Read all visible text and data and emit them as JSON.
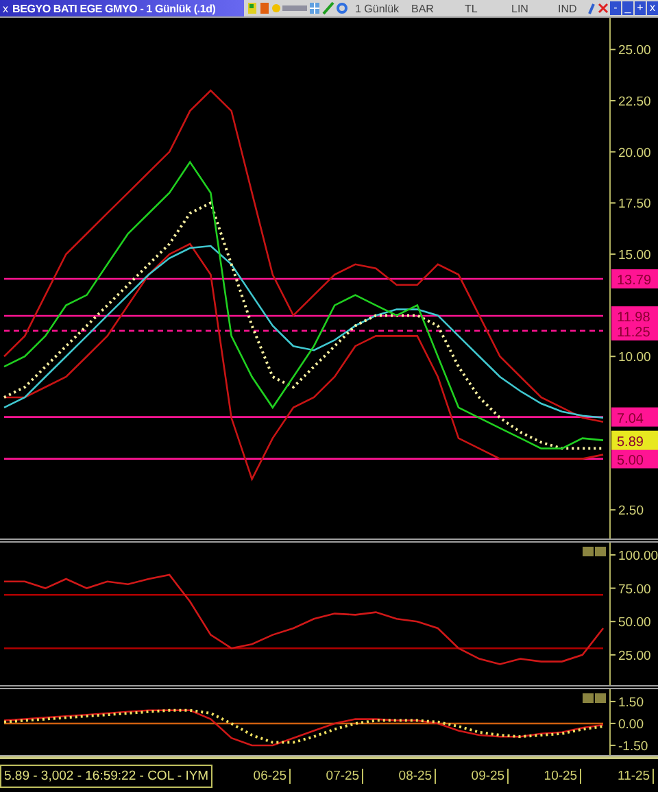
{
  "title_bar": {
    "close": "x",
    "title": "BEGYO BATI EGE GMYO - 1 Günlük (.1d)",
    "period": "1 Günlük",
    "style": "BAR",
    "currency": "TL",
    "scale": "LIN",
    "indicators": "IND",
    "window_buttons": [
      "-",
      "_",
      "+",
      "x"
    ]
  },
  "panels": [
    {
      "chart_data": {
        "type": "line",
        "ylim": [
          1.1,
          26.55
        ],
        "yticks": [
          {
            "value": 25,
            "label": "25.00"
          },
          {
            "value": 22.5,
            "label": "22.50"
          },
          {
            "value": 20,
            "label": "20.00"
          },
          {
            "value": 17.5,
            "label": "17.50"
          },
          {
            "value": 15,
            "label": "15.00"
          },
          {
            "value": 10,
            "label": "10.00"
          },
          {
            "value": 2.5,
            "label": "2.50"
          }
        ],
        "series": [
          {
            "name": "13.79",
            "color": "#ff1493",
            "values": [
              13.79,
              13.79,
              13.79,
              13.79,
              13.79,
              13.79,
              13.79,
              13.79,
              13.79,
              13.79,
              13.79,
              13.79,
              13.79,
              13.79,
              13.79,
              13.79,
              13.79,
              13.79,
              13.79,
              13.79,
              13.79,
              13.79,
              13.79,
              13.79,
              13.79,
              13.79,
              13.79,
              13.79,
              13.79,
              13.79
            ]
          },
          {
            "name": "11.98",
            "color": "#ff1493",
            "values": [
              11.98,
              11.98,
              11.98,
              11.98,
              11.98,
              11.98,
              11.98,
              11.98,
              11.98,
              11.98,
              11.98,
              11.98,
              11.98,
              11.98,
              11.98,
              11.98,
              11.98,
              11.98,
              11.98,
              11.98,
              11.98,
              11.98,
              11.98,
              11.98,
              11.98,
              11.98,
              11.98,
              11.98,
              11.98,
              11.98
            ]
          },
          {
            "name": "11.25",
            "color": "#ff1493",
            "line_style": "dashed",
            "values": [
              11.25,
              11.25,
              11.25,
              11.25,
              11.25,
              11.25,
              11.25,
              11.25,
              11.25,
              11.25,
              11.25,
              11.25,
              11.25,
              11.25,
              11.25,
              11.25,
              11.25,
              11.25,
              11.25,
              11.25,
              11.25,
              11.25,
              11.25,
              11.25,
              11.25,
              11.25,
              11.25,
              11.25,
              11.25,
              11.25
            ]
          },
          {
            "name": "7.04",
            "color": "#ff1493",
            "values": [
              7.04,
              7.04,
              7.04,
              7.04,
              7.04,
              7.04,
              7.04,
              7.04,
              7.04,
              7.04,
              7.04,
              7.04,
              7.04,
              7.04,
              7.04,
              7.04,
              7.04,
              7.04,
              7.04,
              7.04,
              7.04,
              7.04,
              7.04,
              7.04,
              7.04,
              7.04,
              7.04,
              7.04,
              7.04,
              7.04
            ]
          },
          {
            "name": "5.00",
            "color": "#ff1493",
            "values": [
              5,
              5,
              5,
              5,
              5,
              5,
              5,
              5,
              5,
              5,
              5,
              5,
              5,
              5,
              5,
              5,
              5,
              5,
              5,
              5,
              5,
              5,
              5,
              5,
              5,
              5,
              5,
              5,
              5,
              5
            ]
          },
          {
            "color": "#c81414",
            "values": [
              10,
              11,
              13,
              15,
              16,
              17,
              18,
              19,
              20,
              22,
              23,
              22,
              18,
              14,
              12,
              13,
              14,
              14.5,
              14.3,
              13.5,
              13.5,
              14.5,
              14,
              12,
              10,
              9,
              8,
              7.5,
              7,
              6.8
            ]
          },
          {
            "color": "#c81414",
            "values": [
              8,
              8,
              8.5,
              9,
              10,
              11,
              12.5,
              14,
              15,
              15.5,
              14,
              7,
              4,
              6,
              7.5,
              8,
              9,
              10.5,
              11,
              11,
              11,
              9,
              6,
              5.5,
              5,
              5,
              5,
              5,
              5,
              5.2
            ]
          },
          {
            "color": "#40c8d0",
            "values": [
              7.5,
              8,
              9,
              10,
              11,
              12,
              13,
              14,
              14.8,
              15.3,
              15.4,
              14.5,
              13,
              11.5,
              10.5,
              10.3,
              10.8,
              11.5,
              12,
              12.3,
              12.3,
              12,
              11,
              10,
              9,
              8.3,
              7.7,
              7.3,
              7.1,
              7
            ]
          },
          {
            "color": "#f8f0a0",
            "line_style": "dotted",
            "values": [
              8,
              8.5,
              9.5,
              10.5,
              11.5,
              12.5,
              13.5,
              14.5,
              15.5,
              17,
              17.5,
              14.5,
              11.5,
              9,
              8.5,
              9.5,
              10.5,
              11.5,
              12,
              12,
              12,
              11.5,
              9.5,
              8,
              7,
              6.3,
              5.8,
              5.5,
              5.5,
              5.5
            ]
          },
          {
            "color": "#20d020",
            "values": [
              9.5,
              10,
              11,
              12.5,
              13,
              14.5,
              16,
              17,
              18,
              19.5,
              18,
              11,
              9,
              7.5,
              9,
              10.5,
              12.5,
              13,
              12.5,
              12,
              12.5,
              10,
              7.5,
              7,
              6.5,
              6,
              5.5,
              5.5,
              6,
              5.9
            ]
          }
        ],
        "annotations": [
          "5.89"
        ]
      }
    },
    {
      "chart_data": {
        "type": "line",
        "ylim": [
          2.3,
          109.2
        ],
        "yticks": [
          {
            "value": 100,
            "label": "100.00"
          },
          {
            "value": 75,
            "label": "75.00"
          },
          {
            "value": 50,
            "label": "50.00"
          },
          {
            "value": 25,
            "label": "25.00"
          }
        ],
        "series": [
          {
            "color": "#b00000",
            "values": [
              70,
              70,
              70,
              70,
              70,
              70,
              70,
              70,
              70,
              70,
              70,
              70,
              70,
              70,
              70,
              70,
              70,
              70,
              70,
              70,
              70,
              70,
              70,
              70,
              70,
              70,
              70,
              70,
              70,
              70
            ]
          },
          {
            "color": "#b00000",
            "values": [
              30,
              30,
              30,
              30,
              30,
              30,
              30,
              30,
              30,
              30,
              30,
              30,
              30,
              30,
              30,
              30,
              30,
              30,
              30,
              30,
              30,
              30,
              30,
              30,
              30,
              30,
              30,
              30,
              30,
              30
            ]
          },
          {
            "color": "#d01818",
            "values": [
              80,
              80,
              75,
              82,
              75,
              80,
              78,
              82,
              85,
              65,
              40,
              30,
              33,
              40,
              45,
              52,
              56,
              55,
              57,
              52,
              50,
              45,
              30,
              22,
              18,
              22,
              20,
              20,
              25,
              45
            ]
          }
        ]
      }
    },
    {
      "chart_data": {
        "type": "line",
        "ylim": [
          -2.16,
          2.34
        ],
        "yticks": [
          {
            "value": 1.5,
            "label": "1.50"
          },
          {
            "value": 0,
            "label": "0.00"
          },
          {
            "value": -1.5,
            "label": "-1.50"
          }
        ],
        "series": [
          {
            "color": "#d06010",
            "values": [
              0,
              0,
              0,
              0,
              0,
              0,
              0,
              0,
              0,
              0,
              0,
              0,
              0,
              0,
              0,
              0,
              0,
              0,
              0,
              0,
              0,
              0,
              0,
              0,
              0,
              0,
              0,
              0,
              0,
              0
            ]
          },
          {
            "color": "#d01818",
            "values": [
              0.2,
              0.3,
              0.4,
              0.5,
              0.6,
              0.7,
              0.8,
              0.9,
              0.9,
              0.9,
              0.3,
              -1,
              -1.5,
              -1.5,
              -1,
              -0.5,
              0,
              0.3,
              0.3,
              0.2,
              0.2,
              0,
              -0.5,
              -0.8,
              -0.9,
              -0.9,
              -0.7,
              -0.6,
              -0.3,
              -0.1
            ]
          },
          {
            "color": "#f0e060",
            "line_style": "dotted",
            "values": [
              0.1,
              0.2,
              0.3,
              0.4,
              0.5,
              0.6,
              0.7,
              0.8,
              0.9,
              0.9,
              0.7,
              0,
              -0.8,
              -1.3,
              -1.3,
              -0.9,
              -0.4,
              0,
              0.2,
              0.2,
              0.2,
              0.1,
              -0.2,
              -0.6,
              -0.8,
              -0.9,
              -0.8,
              -0.7,
              -0.4,
              -0.2
            ]
          }
        ]
      }
    }
  ],
  "status": "5.89 - 3,002 - 16:59:22 - COL - IYM",
  "time_axis": [
    "06-25",
    "07-25",
    "08-25",
    "09-25",
    "10-25",
    "11-25"
  ]
}
